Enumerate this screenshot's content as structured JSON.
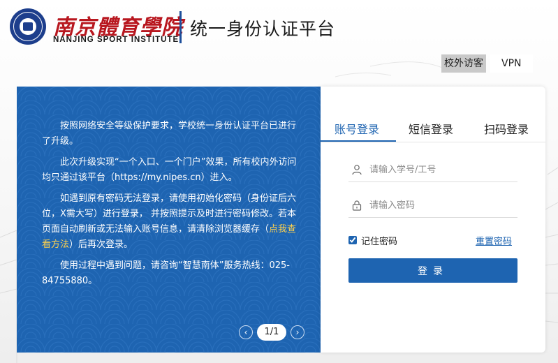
{
  "header": {
    "cn_name": "南京體育學院",
    "en_name": "NANJING SPORT INSTITUTE",
    "platform_title": "统一身份认证平台"
  },
  "top_links": {
    "off_campus": "校外访客",
    "vpn": "VPN"
  },
  "notice": {
    "p1": "按照网络安全等级保护要求，学校统一身份认证平台已进行了升级。",
    "p2": "此次升级实现“一个入口、一个门户”效果，所有校内外访问均只通过该平台（https://my.nipes.cn）进入。",
    "p3_a": "如遇到原有密码无法登录，请使用初始化密码（身份证后六位，X需大写）进行登录， 并按照提示及时进行密码修改。若本页面自动刷新或无法输入账号信息，请清除浏览器缓存（",
    "p3_link": "点我查看方法",
    "p3_b": "）后再次登录。",
    "p4": "使用过程中遇到问题，请咨询“智慧南体”服务热线：025-84755880。",
    "pager": "1/1",
    "prev_icon": "chevron-left-icon",
    "next_icon": "chevron-right-icon"
  },
  "login": {
    "tabs": [
      {
        "label": "账号登录"
      },
      {
        "label": "短信登录"
      },
      {
        "label": "扫码登录"
      }
    ],
    "user_placeholder": "请输入学号/工号",
    "user_value": "",
    "pass_placeholder": "请输入密码",
    "pass_value": "",
    "remember_label": "记住密码",
    "reset_label": "重置密码",
    "submit_label": "登录"
  },
  "colors": {
    "brand_blue": "#1e64b1",
    "brand_red": "#b8171f"
  }
}
